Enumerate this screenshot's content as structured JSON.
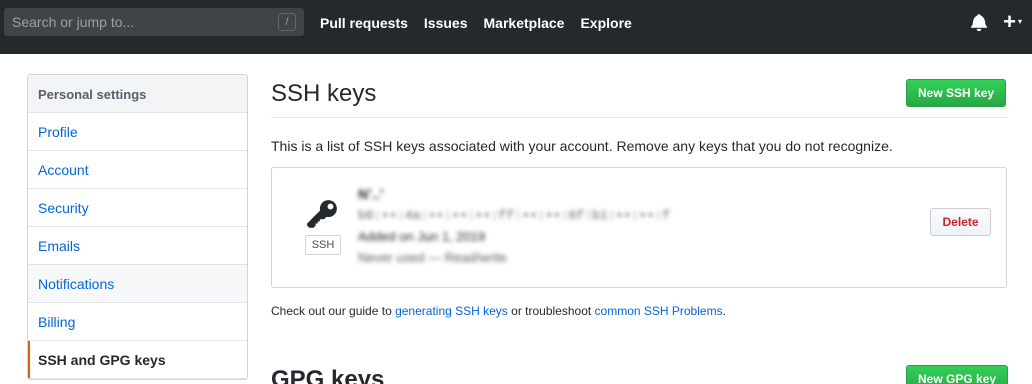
{
  "header": {
    "search_placeholder": "Search or jump to...",
    "search_shortcut": "/",
    "nav": [
      "Pull requests",
      "Issues",
      "Marketplace",
      "Explore"
    ],
    "plus_label": "+",
    "caret": "▾"
  },
  "sidebar": {
    "heading": "Personal settings",
    "items": [
      {
        "label": "Profile"
      },
      {
        "label": "Account"
      },
      {
        "label": "Security"
      },
      {
        "label": "Emails"
      },
      {
        "label": "Notifications"
      },
      {
        "label": "Billing"
      },
      {
        "label": "SSH and GPG keys"
      }
    ]
  },
  "main": {
    "title": "SSH keys",
    "new_ssh_label": "New SSH key",
    "description": "This is a list of SSH keys associated with your account. Remove any keys that you do not recognize.",
    "key": {
      "badge": "SSH",
      "title": "Nʼ..ʼ",
      "fingerprint": "b6:••:4a:••:••:••:ff:••:••:6f:b1:••:••:f",
      "added": "Added on Jun 1, 2019",
      "usage": "Never used — Read/write",
      "delete_label": "Delete"
    },
    "guide": {
      "prefix": "Check out our guide to ",
      "link1": "generating SSH keys",
      "middle": " or troubleshoot ",
      "link2": "common SSH Problems",
      "suffix": "."
    },
    "gpg_title": "GPG keys",
    "new_gpg_label": "New GPG key"
  }
}
